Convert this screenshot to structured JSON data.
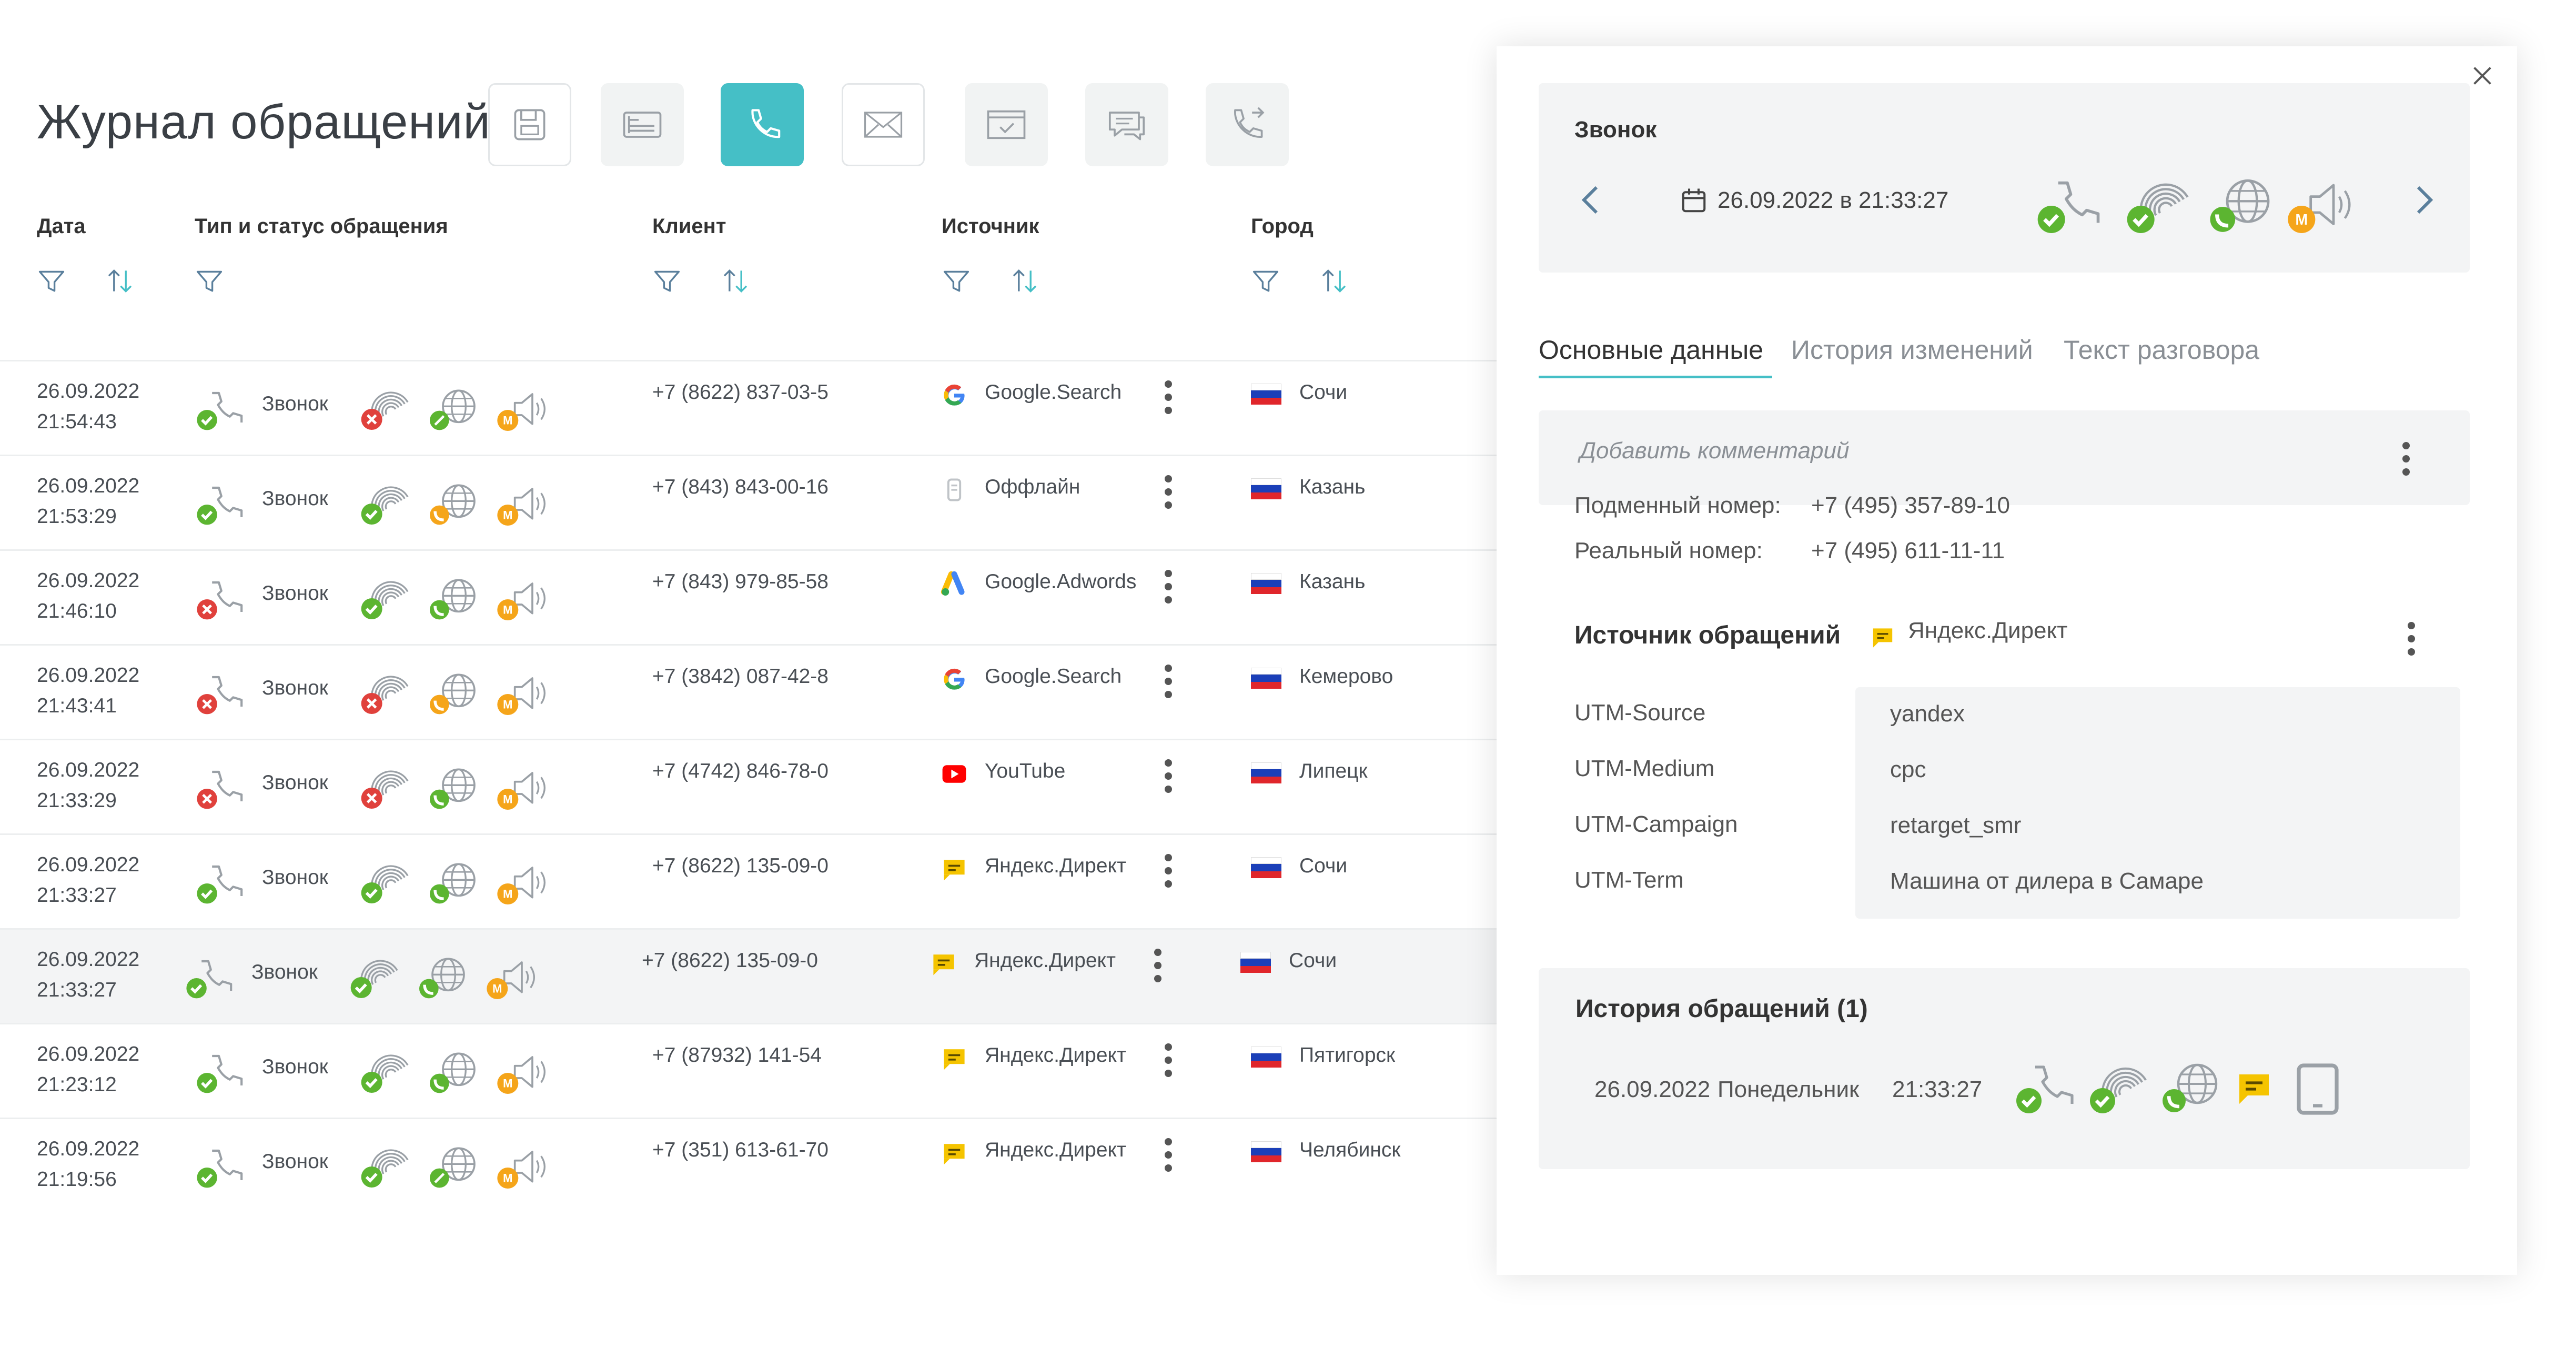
{
  "header": {
    "title": "Журнал обращений"
  },
  "toolbar": {
    "buttons": [
      {
        "icon": "save-icon"
      },
      {
        "icon": "form-icon"
      },
      {
        "icon": "phone-icon",
        "active": true
      },
      {
        "icon": "mail-icon"
      },
      {
        "icon": "window-icon"
      },
      {
        "icon": "chat-icon"
      },
      {
        "icon": "callback-icon"
      }
    ],
    "accent_color": "#45bfc6"
  },
  "table": {
    "columns": {
      "date": "Дата",
      "type": "Тип и статус обращения",
      "client": "Клиент",
      "source": "Источник",
      "city": "Город"
    },
    "rows": [
      {
        "date": "26.09.2022",
        "time": "21:54:43",
        "type": "Звонок",
        "call_ok": true,
        "fp": "fail",
        "web": "link",
        "client": "+7 (8622) 837-03-5",
        "source": "Google.Search",
        "src_icon": "google",
        "city": "Сочи"
      },
      {
        "date": "26.09.2022",
        "time": "21:53:29",
        "type": "Звонок",
        "call_ok": true,
        "fp": "ok",
        "web": "phone-orange",
        "client": "+7 (843) 843-00-16",
        "source": "Оффлайн",
        "src_icon": "offline",
        "city": "Казань"
      },
      {
        "date": "26.09.2022",
        "time": "21:46:10",
        "type": "Звонок",
        "call_ok": false,
        "fp": "ok",
        "web": "phone",
        "client": "+7 (843) 979-85-58",
        "source": "Google.Adwords",
        "src_icon": "adwords",
        "city": "Казань"
      },
      {
        "date": "26.09.2022",
        "time": "21:43:41",
        "type": "Звонок",
        "call_ok": false,
        "fp": "fail",
        "web": "phone-orange",
        "client": "+7 (3842) 087-42-8",
        "source": "Google.Search",
        "src_icon": "google",
        "city": "Кемерово"
      },
      {
        "date": "26.09.2022",
        "time": "21:33:29",
        "type": "Звонок",
        "call_ok": false,
        "fp": "fail",
        "web": "phone",
        "client": "+7 (4742) 846-78-0",
        "source": "YouTube",
        "src_icon": "youtube",
        "city": "Липецк"
      },
      {
        "date": "26.09.2022",
        "time": "21:33:27",
        "type": "Звонок",
        "call_ok": true,
        "fp": "ok",
        "web": "phone",
        "client": "+7 (8622) 135-09-0",
        "source": "Яндекс.Директ",
        "src_icon": "yandex",
        "city": "Сочи"
      },
      {
        "date": "26.09.2022",
        "time": "21:33:27",
        "type": "Звонок",
        "call_ok": true,
        "fp": "ok",
        "web": "phone",
        "client": "+7 (8622) 135-09-0",
        "source": "Яндекс.Директ",
        "src_icon": "yandex",
        "city": "Сочи",
        "selected": true
      },
      {
        "date": "26.09.2022",
        "time": "21:23:12",
        "type": "Звонок",
        "call_ok": true,
        "fp": "ok",
        "web": "phone",
        "client": "+7 (87932) 141-54",
        "source": "Яндекс.Директ",
        "src_icon": "yandex",
        "city": "Пятигорск"
      },
      {
        "date": "26.09.2022",
        "time": "21:19:56",
        "type": "Звонок",
        "call_ok": true,
        "fp": "ok",
        "web": "link",
        "client": "+7 (351) 613-61-70",
        "source": "Яндекс.Директ",
        "src_icon": "yandex",
        "city": "Челябинск"
      }
    ]
  },
  "panel": {
    "title": "Звонок",
    "datetime": "26.09.2022 в 21:33:27",
    "tabs": [
      "Основные данные",
      "История изменений",
      "Текст разговора"
    ],
    "comment_placeholder": "Добавить комментарий",
    "substitute_label": "Подменный номер:",
    "substitute_value": "+7 (495) 357-89-10",
    "real_label": "Реальный номер:",
    "real_value": "+7 (495) 611-11-11",
    "source_label": "Источник обращений",
    "source_value": "Яндекс.Директ",
    "utm": [
      {
        "key": "UTM-Source",
        "value": "yandex"
      },
      {
        "key": "UTM-Medium",
        "value": "cpc"
      },
      {
        "key": "UTM-Campaign",
        "value": "retarget_smr"
      },
      {
        "key": "UTM-Term",
        "value": "Машина от дилера в Самаре"
      }
    ],
    "history_title": "История обращений (1)",
    "history_date": "26.09.2022",
    "history_day": "Понедельник",
    "history_time": "21:33:27"
  }
}
